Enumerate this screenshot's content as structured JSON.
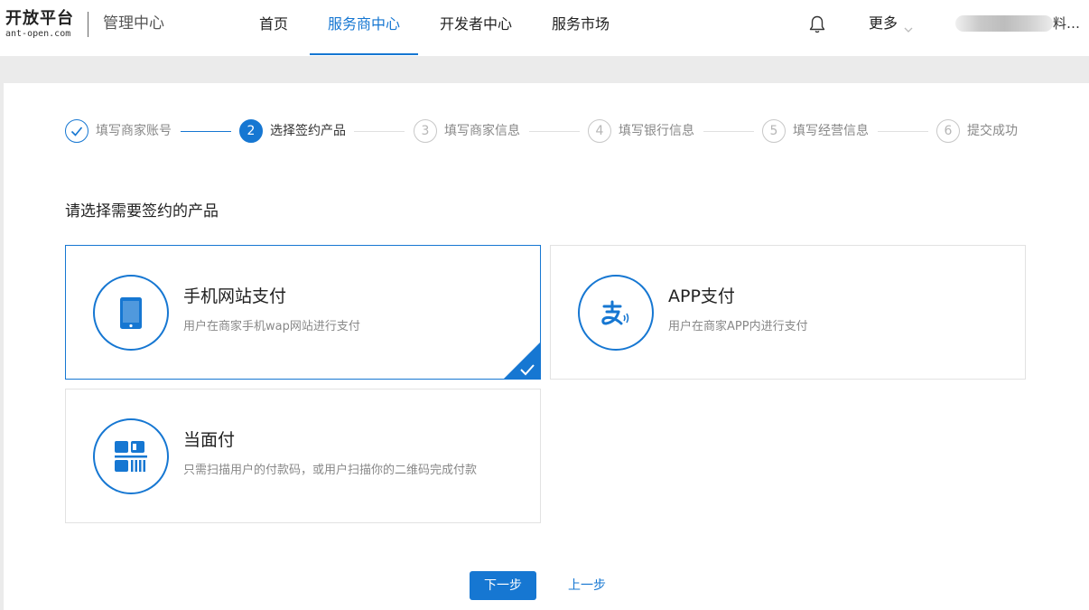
{
  "header": {
    "logo_main": "开放平台",
    "logo_sub": "ant-open.com",
    "portal_title": "管理中心",
    "nav": [
      {
        "label": "首页",
        "active": false
      },
      {
        "label": "服务商中心",
        "active": true
      },
      {
        "label": "开发者中心",
        "active": false
      },
      {
        "label": "服务市场",
        "active": false
      }
    ],
    "more_label": "更多",
    "user_name_tail": "料…",
    "accent_color": "#1677d2"
  },
  "steps": [
    {
      "number": "1",
      "label": "填写商家账号",
      "state": "done"
    },
    {
      "number": "2",
      "label": "选择签约产品",
      "state": "current"
    },
    {
      "number": "3",
      "label": "填写商家信息",
      "state": "todo"
    },
    {
      "number": "4",
      "label": "填写银行信息",
      "state": "todo"
    },
    {
      "number": "5",
      "label": "填写经营信息",
      "state": "todo"
    },
    {
      "number": "6",
      "label": "提交成功",
      "state": "todo"
    }
  ],
  "section_title": "请选择需要签约的产品",
  "products": [
    {
      "icon": "mobile-phone-icon",
      "title": "手机网站支付",
      "desc": "用户在商家手机wap网站进行支付",
      "selected": true
    },
    {
      "icon": "alipay-app-icon",
      "title": "APP支付",
      "desc": "用户在商家APP内进行支付",
      "selected": false
    },
    {
      "icon": "qr-code-icon",
      "title": "当面付",
      "desc": "只需扫描用户的付款码，或用户扫描你的二维码完成付款",
      "selected": false
    }
  ],
  "actions": {
    "next_label": "下一步",
    "prev_label": "上一步"
  }
}
